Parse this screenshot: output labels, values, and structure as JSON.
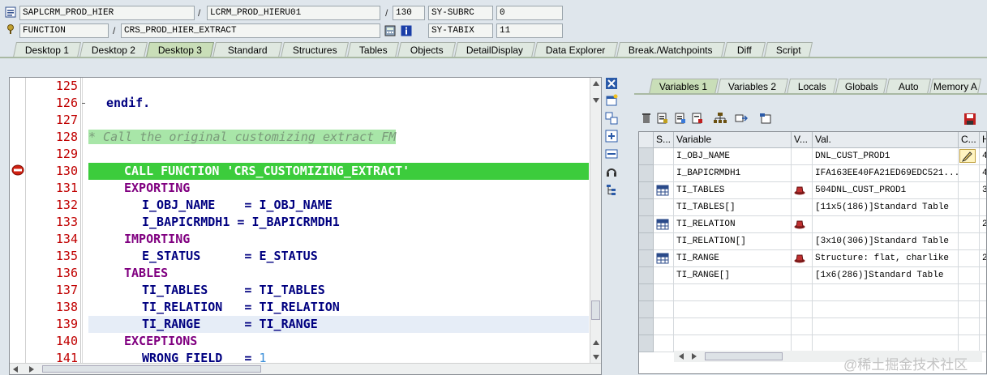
{
  "header": {
    "program": "SAPLCRM_PROD_HIER",
    "include": "LCRM_PROD_HIERU01",
    "line": "130",
    "sysubrc_label": "SY-SUBRC",
    "sysubrc_value": "0",
    "event_type": "FUNCTION",
    "event_name": "CRS_PROD_HIER_EXTRACT",
    "sytabix_label": "SY-TABIX",
    "sytabix_value": "11",
    "slash": "/"
  },
  "tabs": [
    "Desktop 1",
    "Desktop 2",
    "Desktop 3",
    "Standard",
    "Structures",
    "Tables",
    "Objects",
    "DetailDisplay",
    "Data Explorer",
    "Break./Watchpoints",
    "Diff",
    "Script"
  ],
  "active_tab": "Desktop 3",
  "editor": {
    "lines": [
      {
        "n": "125",
        "text": ""
      },
      {
        "n": "126",
        "text": "endif."
      },
      {
        "n": "127",
        "text": ""
      },
      {
        "n": "128",
        "text": "* Call the original customizing extract FM"
      },
      {
        "n": "129",
        "text": ""
      },
      {
        "n": "130",
        "text": "CALL FUNCTION 'CRS_CUSTOMIZING_EXTRACT'"
      },
      {
        "n": "131",
        "text": "EXPORTING"
      },
      {
        "n": "132",
        "text": "I_OBJ_NAME    = I_OBJ_NAME"
      },
      {
        "n": "133",
        "text": "I_BAPICRMDH1 = I_BAPICRMDH1"
      },
      {
        "n": "134",
        "text": "IMPORTING"
      },
      {
        "n": "135",
        "text": "E_STATUS      = E_STATUS"
      },
      {
        "n": "136",
        "text": "TABLES"
      },
      {
        "n": "137",
        "text": "TI_TABLES     = TI_TABLES"
      },
      {
        "n": "138",
        "text": "TI_RELATION   = TI_RELATION"
      },
      {
        "n": "139",
        "text": "TI_RANGE      = TI_RANGE"
      },
      {
        "n": "140",
        "text": "EXCEPTIONS"
      },
      {
        "n": "141",
        "text": "WRONG_FIELD   = "
      }
    ],
    "literal_141": "1"
  },
  "right_tabs": [
    "Variables 1",
    "Variables 2",
    "Locals",
    "Globals",
    "Auto",
    "Memory A"
  ],
  "grid": {
    "headers": [
      "S...",
      "Variable",
      "V...",
      "Val.",
      "C...",
      "H"
    ],
    "rows": [
      {
        "var": "I_OBJ_NAME",
        "val": "DNL_CUST_PROD1",
        "h": "4",
        "icon": "",
        "edit": true,
        "table": false
      },
      {
        "var": "I_BAPICRMDH1",
        "val": "IFA163EE40FA21ED69EDC521...",
        "h": "4",
        "icon": "",
        "edit": false,
        "table": false
      },
      {
        "var": "TI_TABLES",
        "val": "504DNL_CUST_PROD1",
        "h": "3",
        "icon": "hat",
        "edit": false,
        "table": true
      },
      {
        "var": "TI_TABLES[]",
        "val": "[11x5(186)]Standard Table",
        "h": "",
        "icon": "",
        "edit": false,
        "table": false
      },
      {
        "var": "TI_RELATION",
        "val": "",
        "h": "2",
        "icon": "hat",
        "edit": false,
        "table": true
      },
      {
        "var": "TI_RELATION[]",
        "val": "[3x10(306)]Standard Table",
        "h": "",
        "icon": "",
        "edit": false,
        "table": false
      },
      {
        "var": "TI_RANGE",
        "val": "Structure: flat, charlike",
        "h": "2",
        "icon": "hat",
        "edit": false,
        "table": true
      },
      {
        "var": "TI_RANGE[]",
        "val": "[1x6(286)]Standard Table",
        "h": "",
        "icon": "",
        "edit": false,
        "table": false
      }
    ]
  },
  "colors": {
    "exec_line": "#3ccc3c",
    "comment_bg": "#a8e6a8",
    "line_number": "#c00000",
    "keyword": "#000080",
    "keyword2": "#800080"
  },
  "watermark": "@稀土掘金技术社区"
}
